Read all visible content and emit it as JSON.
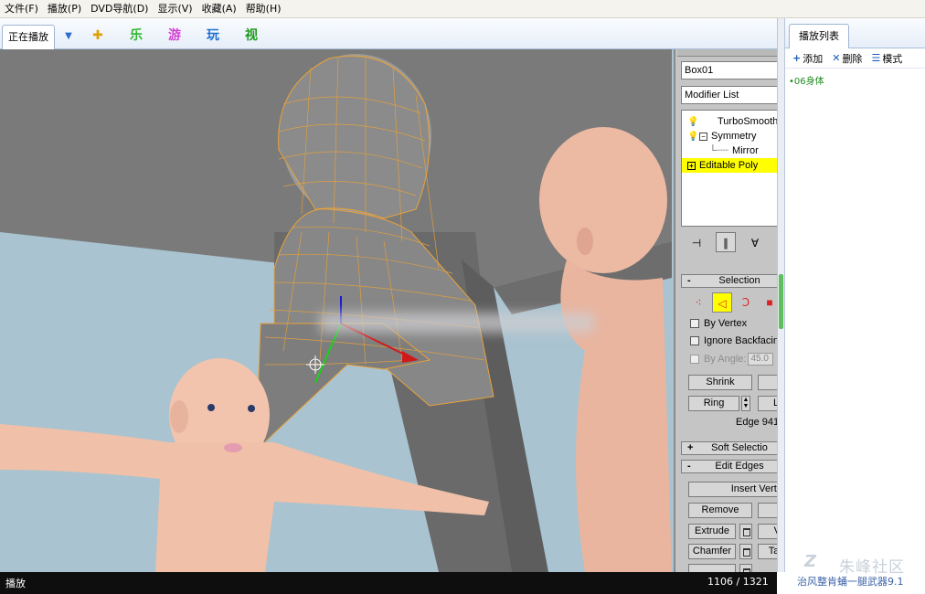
{
  "menubar": {
    "items": [
      "文件(F)",
      "播放(P)",
      "DVD导航(D)",
      "显示(V)",
      "收藏(A)",
      "帮助(H)"
    ]
  },
  "tabs_left": {
    "now_playing": "正在播放",
    "icons": [
      {
        "name": "game-icon",
        "glyph": "🎲",
        "color": "#e0a000"
      },
      {
        "name": "music-icon",
        "glyph": "乐",
        "color": "#2db82d"
      },
      {
        "name": "play-icon",
        "glyph": "游",
        "color": "#d43fd4"
      },
      {
        "name": "fun-icon",
        "glyph": "玩",
        "color": "#1f6fd0"
      },
      {
        "name": "video-icon",
        "glyph": "视",
        "color": "#1e9a1e"
      }
    ]
  },
  "right_panel": {
    "tab_label": "播放列表",
    "toolbar": {
      "add": "添加",
      "delete": "删除",
      "mode": "模式"
    },
    "items": [
      "06身体"
    ],
    "watermark": {
      "brand": "朱峰社区",
      "caption": "治风整肯蛹一腿武器9.1"
    }
  },
  "max_panel": {
    "object_name": "Box01",
    "modifier_list": "Modifier List",
    "stack": {
      "turbosmooth": "TurboSmooth",
      "symmetry": "Symmetry",
      "mirror": "Mirror",
      "editable_poly": "Editable Poly"
    },
    "rollouts": {
      "selection": "Selection",
      "soft_selection": "Soft Selectio",
      "edit_edges": "Edit Edges"
    },
    "checks": {
      "by_vertex": "By Vertex",
      "ignore_backfacing": "Ignore Backfacin",
      "by_angle": "By Angle:",
      "by_angle_value": "45.0"
    },
    "buttons": {
      "shrink": "Shrink",
      "ring": "Ring",
      "loop": "L",
      "insert_vertex": "Insert Verte",
      "remove": "Remove",
      "extrude": "Extrude",
      "extrude_right": "V",
      "chamfer": "Chamfer",
      "chamfer_right": "Tar"
    },
    "edge_count": "Edge 941"
  },
  "status": {
    "state": "播放",
    "position": "1106 / 1321"
  }
}
